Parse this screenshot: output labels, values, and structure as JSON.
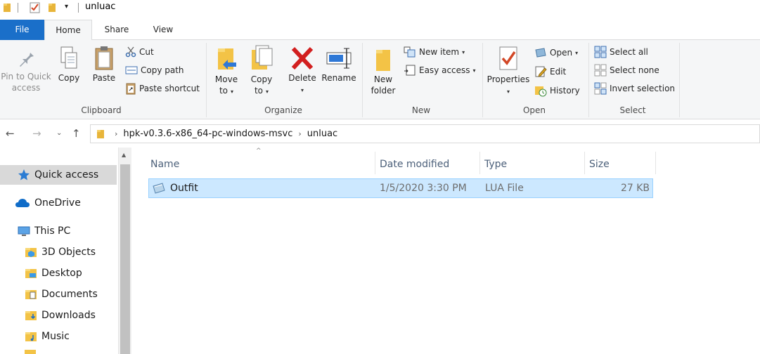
{
  "window": {
    "title": "unluac"
  },
  "tabs": {
    "file": "File",
    "home": "Home",
    "share": "Share",
    "view": "View"
  },
  "ribbon": {
    "clipboard": {
      "label": "Clipboard",
      "pin_line1": "Pin to Quick",
      "pin_line2": "access",
      "copy": "Copy",
      "paste": "Paste",
      "cut": "Cut",
      "copy_path": "Copy path",
      "paste_shortcut": "Paste shortcut"
    },
    "organize": {
      "label": "Organize",
      "move_line1": "Move",
      "move_line2": "to",
      "copy_line1": "Copy",
      "copy_line2": "to",
      "delete": "Delete",
      "rename": "Rename"
    },
    "new": {
      "label": "New",
      "folder_line1": "New",
      "folder_line2": "folder",
      "new_item": "New item",
      "easy_access": "Easy access"
    },
    "open": {
      "label": "Open",
      "properties": "Properties",
      "open": "Open",
      "edit": "Edit",
      "history": "History"
    },
    "select": {
      "label": "Select",
      "select_all": "Select all",
      "select_none": "Select none",
      "invert": "Invert selection"
    }
  },
  "address": {
    "crumbs": [
      "hpk-v0.3.6-x86_64-pc-windows-msvc",
      "unluac"
    ]
  },
  "sidebar": {
    "items": [
      {
        "label": "Quick access",
        "icon": "star-icon"
      },
      {
        "label": "OneDrive",
        "icon": "cloud-icon"
      },
      {
        "label": "This PC",
        "icon": "computer-icon"
      },
      {
        "label": "3D Objects",
        "icon": "folder-3d-icon"
      },
      {
        "label": "Desktop",
        "icon": "folder-desktop-icon"
      },
      {
        "label": "Documents",
        "icon": "folder-documents-icon"
      },
      {
        "label": "Downloads",
        "icon": "folder-downloads-icon"
      },
      {
        "label": "Music",
        "icon": "folder-music-icon"
      }
    ]
  },
  "filelist": {
    "columns": {
      "name": "Name",
      "date": "Date modified",
      "type": "Type",
      "size": "Size"
    },
    "rows": [
      {
        "name": "Outfit",
        "date": "1/5/2020 3:30 PM",
        "type": "LUA File",
        "size": "27 KB"
      }
    ]
  },
  "colors": {
    "accent": "#1a6fc9",
    "selection": "#cce8ff",
    "selection_border": "#99d1ff"
  }
}
